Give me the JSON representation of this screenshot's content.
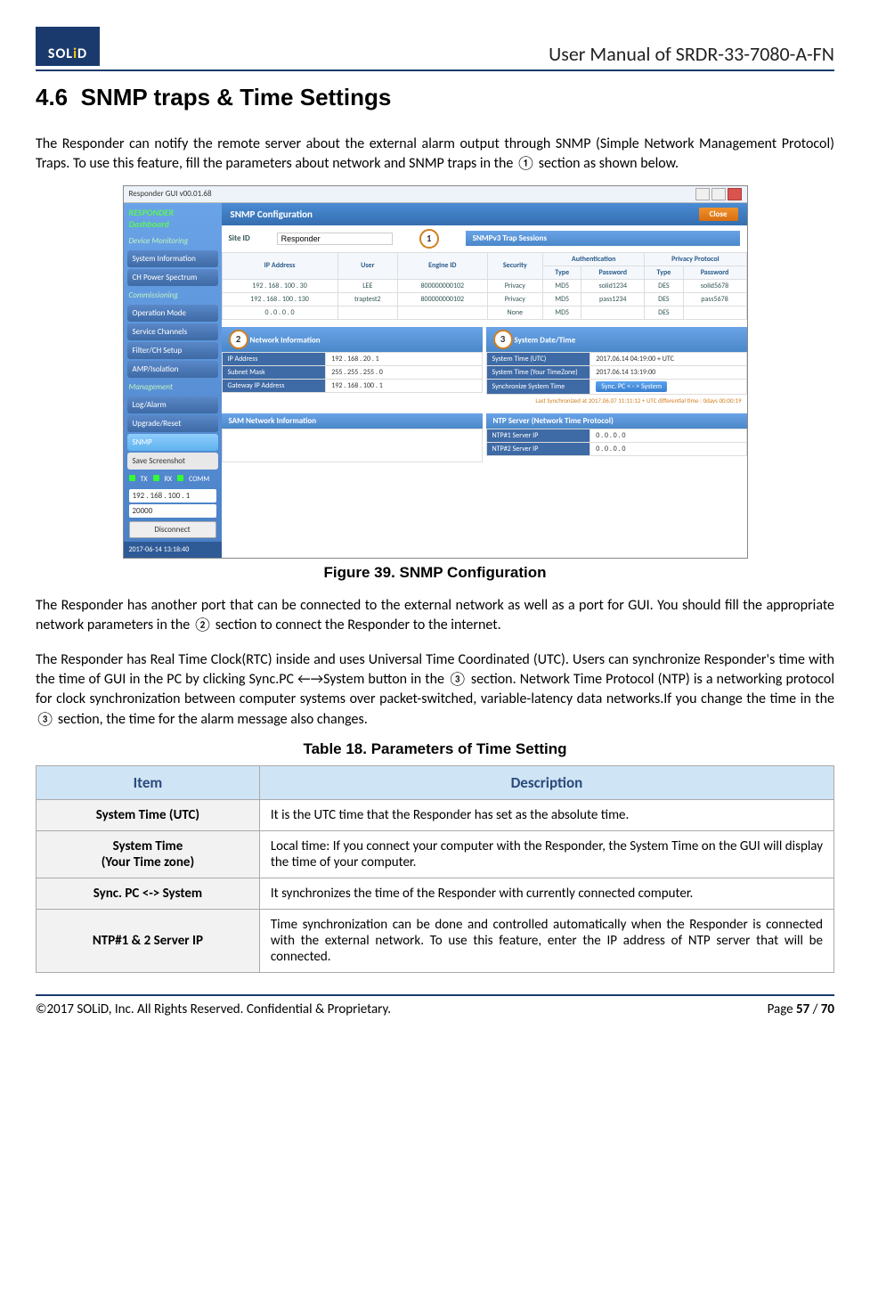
{
  "header": {
    "logo_text_prefix": "SOL",
    "logo_text_i": "i",
    "logo_text_suffix": "D",
    "doc_title": "User Manual of SRDR-33-7080-A-FN"
  },
  "section": {
    "number": "4.6",
    "title": "SNMP traps & Time Settings"
  },
  "paragraphs": {
    "p1": "The Responder can notify the remote server about the external alarm output through SNMP (Simple Network Management Protocol) Traps. To use this feature, fill the  parameters about network and SNMP traps in the ① section as shown below.",
    "p2": "The Responder has another port that can be connected to the external network as well as a port for GUI. You should fill the appropriate network parameters in the ② section to connect the Responder to the internet.",
    "p3": "The Responder has Real Time Clock(RTC) inside and uses Universal Time Coordinated (UTC). Users can synchronize Responder's time with the time of GUI in the PC by clicking  Sync.PC ←→System button in the ③ section. Network Time Protocol (NTP) is a networking protocol for clock synchronization between computer systems over packet-switched, variable-latency data networks.If you change the time in the ③ section, the time for the alarm message also changes."
  },
  "figure": {
    "caption": "Figure 39. SNMP Configuration",
    "window_title": "Responder GUI v00.01.68",
    "sidebar": {
      "dashboard": "RESPONDER Dashboard",
      "sections": {
        "monitoring": "Device Monitoring",
        "commissioning": "Commissioning",
        "management": "Management"
      },
      "items": {
        "sys_info": "System Information",
        "ch_power": "CH Power Spectrum",
        "op_mode": "Operation Mode",
        "svc_ch": "Service Channels",
        "filter": "Filter/CH Setup",
        "amp": "AMP/Isolation",
        "log": "Log/Alarm",
        "upgrade": "Upgrade/Reset",
        "snmp": "SNMP",
        "save": "Save Screenshot"
      },
      "status": {
        "tx": "TX",
        "rx": "RX",
        "comm": "COMM"
      },
      "ip": "192 . 168 . 100 . 1",
      "port": "20000",
      "disconnect": "Disconnect",
      "timestamp": "2017-06-14 13:18:40"
    },
    "main": {
      "title": "SNMP Configuration",
      "close": "Close",
      "site_id_label": "Site ID",
      "site_id_value": "Responder",
      "sub_trap": "SNMPv3 Trap Sessions",
      "trap_headers": {
        "ip": "IP Address",
        "user": "User",
        "engine": "Engine ID",
        "security": "Security",
        "auth": "Authentication",
        "auth_type": "Type",
        "auth_pw": "Password",
        "priv": "Privacy Protocol",
        "priv_type": "Type",
        "priv_pw": "Password"
      },
      "trap_rows": [
        {
          "ip": "192 . 168 . 100 . 30",
          "user": "LEE",
          "engine": "800000000102",
          "sec": "Privacy",
          "atype": "MD5",
          "apw": "solid1234",
          "ptype": "DES",
          "ppw": "solid5678"
        },
        {
          "ip": "192 . 168 . 100 . 130",
          "user": "traptest2",
          "engine": "800000000102",
          "sec": "Privacy",
          "atype": "MD5",
          "apw": "pass1234",
          "ptype": "DES",
          "ppw": "pass5678"
        },
        {
          "ip": "0 . 0 . 0 . 0",
          "user": "",
          "engine": "",
          "sec": "None",
          "atype": "MD5",
          "apw": "",
          "ptype": "DES",
          "ppw": ""
        }
      ],
      "netinfo": {
        "header": "Network Information",
        "ip_label": "IP Address",
        "ip": "192 . 168 . 20 . 1",
        "mask_label": "Subnet Mask",
        "mask": "255 . 255 . 255 . 0",
        "gw_label": "Gateway IP Address",
        "gw": "192 . 168 . 100 . 1"
      },
      "datetime": {
        "header": "System Date/Time",
        "utc_label": "System Time (UTC)",
        "utc": "2017.06.14 04:19:00 + UTC",
        "tz_label": "System Time (Your TimeZone)",
        "tz": "2017.06.14 13:19:00",
        "sync_label": "Synchronize System Time",
        "sync_btn": "Sync. PC < - > System",
        "note": "Last Synchronized at 2017.06.07 11:11:12 + UTC differential time : 0days 00:00:19"
      },
      "sam": {
        "header": "SAM Network Information"
      },
      "ntp": {
        "header": "NTP Server (Network Time Protocol)",
        "s1_label": "NTP#1 Server IP",
        "s1": "0 . 0 . 0 . 0",
        "s2_label": "NTP#2 Server IP",
        "s2": "0 . 0 . 0 . 0"
      }
    }
  },
  "table": {
    "caption": "Table 18. Parameters of Time Setting",
    "headers": {
      "item": "Item",
      "desc": "Description"
    },
    "rows": [
      {
        "item": "System Time (UTC)",
        "desc": "It is the UTC time that the Responder has set as the absolute time."
      },
      {
        "item": "System Time\n(Your Time zone)",
        "desc": "Local time: If you connect your computer with the Responder, the System Time on the GUI will display the time of your computer."
      },
      {
        "item": "Sync. PC <-> System",
        "desc": "It synchronizes the time of the Responder with currently connected computer."
      },
      {
        "item": "NTP#1 & 2 Server IP",
        "desc": "Time synchronization can be done and controlled automatically when the Responder is connected with the external network. To use this feature, enter the IP address of NTP server that will be connected."
      }
    ]
  },
  "footer": {
    "copyright": "©2017 SOLiD, Inc. All Rights Reserved. Confidential & Proprietary.",
    "page": "Page 57 / 70"
  }
}
